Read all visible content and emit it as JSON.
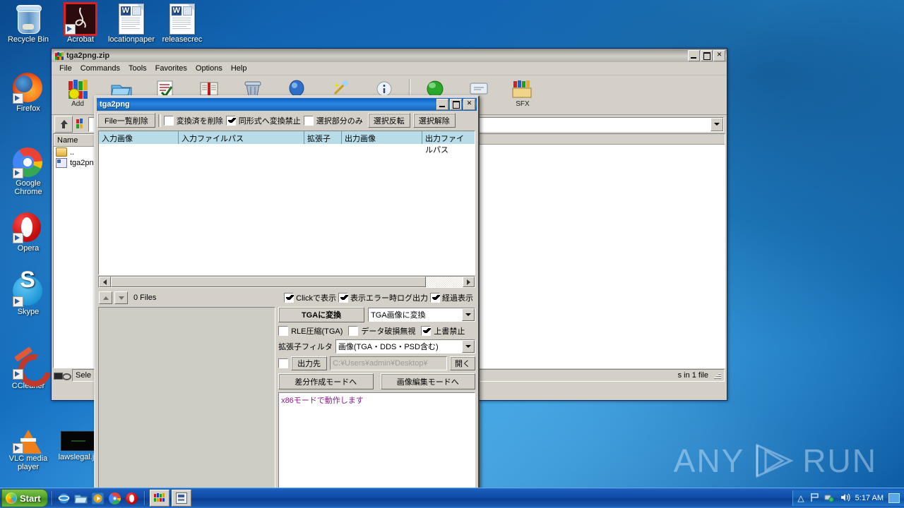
{
  "desktop": {
    "icons": [
      {
        "label": "Recycle Bin",
        "icon": "recycle-bin-icon"
      },
      {
        "label": "Acrobat",
        "icon": "acrobat-pdf-icon"
      },
      {
        "label": "locationpaper",
        "icon": "word-document-icon"
      },
      {
        "label": "releasecrec",
        "icon": "word-document-icon"
      },
      {
        "label": "Firefox",
        "icon": "firefox-icon"
      },
      {
        "label": "Google Chrome",
        "icon": "chrome-icon"
      },
      {
        "label": "Opera",
        "icon": "opera-icon"
      },
      {
        "label": "Skype",
        "icon": "skype-icon"
      },
      {
        "label": "CCleaner",
        "icon": "ccleaner-icon"
      },
      {
        "label": "VLC media player",
        "icon": "vlc-icon"
      },
      {
        "label": "lawslegal.jp",
        "icon": "black-thumbnail-icon"
      }
    ],
    "watermark": "ANY RUN",
    "watermark_left": "ANY",
    "watermark_right": "RUN"
  },
  "winrar": {
    "title": "tga2png.zip",
    "menu": [
      "File",
      "Commands",
      "Tools",
      "Favorites",
      "Options",
      "Help"
    ],
    "toolbar": [
      {
        "label": "Add",
        "icon": "add-archive-icon"
      },
      {
        "label": "",
        "icon": "extract-to-icon"
      },
      {
        "label": "",
        "icon": "test-icon"
      },
      {
        "label": "",
        "icon": "view-icon"
      },
      {
        "label": "",
        "icon": "delete-icon"
      },
      {
        "label": "",
        "icon": "find-icon"
      },
      {
        "label": "",
        "icon": "wizard-icon"
      },
      {
        "label": "",
        "icon": "info-icon"
      },
      {
        "label": "",
        "icon": "repair-icon"
      },
      {
        "label": "",
        "icon": "comment-icon"
      },
      {
        "label": "SFX",
        "icon": "sfx-icon"
      }
    ],
    "address_value": "",
    "columns": [
      "Name"
    ],
    "files": [
      {
        "name": "..",
        "icon": "folder-up-icon"
      },
      {
        "name": "tga2png",
        "icon": "file-icon"
      }
    ],
    "status_left": "Sele",
    "status_right": "s in 1 file",
    "window_buttons": [
      "minimize",
      "maximize",
      "close"
    ]
  },
  "tga2png": {
    "title": "tga2png",
    "window_buttons": [
      "minimize",
      "maximize",
      "close"
    ],
    "toolbar": {
      "clear_list_button": "File一覧削除",
      "delete_converted": {
        "label": "変換済を削除",
        "checked": false
      },
      "forbid_same_format": {
        "label": "同形式へ変換禁止",
        "checked": true
      },
      "selection_only": {
        "label": "選択部分のみ",
        "checked": false
      },
      "invert_selection_button": "選択反転",
      "deselect_button": "選択解除"
    },
    "grid": {
      "columns": [
        "入力画像",
        "入力ファイルパス",
        "拡張子",
        "出力画像",
        "出力ファイルパス"
      ],
      "rows": []
    },
    "file_count": "0 Files",
    "options": {
      "click_display": {
        "label": "Clickで表示",
        "checked": true
      },
      "error_log_output": {
        "label": "表示エラー時ログ出力",
        "checked": true
      },
      "progress_display": {
        "label": "経過表示",
        "checked": true
      }
    },
    "convert_button": "TGAに変換",
    "convert_mode_value": "TGA画像に変換",
    "rle_compression": {
      "label": "RLE圧縮(TGA)",
      "checked": false
    },
    "ignore_corrupt": {
      "label": "データ破損無視",
      "checked": false
    },
    "no_overwrite": {
      "label": "上書禁止",
      "checked": true
    },
    "extension_filter_label": "拡張子フィルタ",
    "extension_filter_value": "画像(TGA・DDS・PSD含む)",
    "output_dest": {
      "checked": false,
      "button": "出力先",
      "path": "C:¥Users¥admin¥Desktop¥",
      "open_button": "開く"
    },
    "diff_mode_button": "差分作成モードへ",
    "image_edit_mode_button": "画像編集モードへ",
    "log_text": "x86モードで動作します"
  },
  "taskbar": {
    "start_label": "Start",
    "quicklaunch": [
      {
        "icon": "internet-explorer-icon"
      },
      {
        "icon": "show-desktop-icon"
      },
      {
        "icon": "media-player-icon"
      },
      {
        "icon": "chrome-icon"
      },
      {
        "icon": "opera-icon"
      }
    ],
    "tasks": [
      {
        "icon": "winrar-icon"
      },
      {
        "icon": "tga2png-icon"
      }
    ],
    "tray": {
      "show_hidden": "show-hidden-icons-icon",
      "flag": "action-center-icon",
      "network": "network-icon",
      "volume": "volume-icon",
      "clock": "5:17 AM",
      "showdesktop": "show-desktop-button"
    }
  },
  "colors": {
    "desktop_blue": "#1675c8",
    "dialog_face": "#d4d0c8",
    "grid_header": "#b8dce8",
    "title_active": "#0a61c8",
    "log_text": "#8b1a8b"
  }
}
